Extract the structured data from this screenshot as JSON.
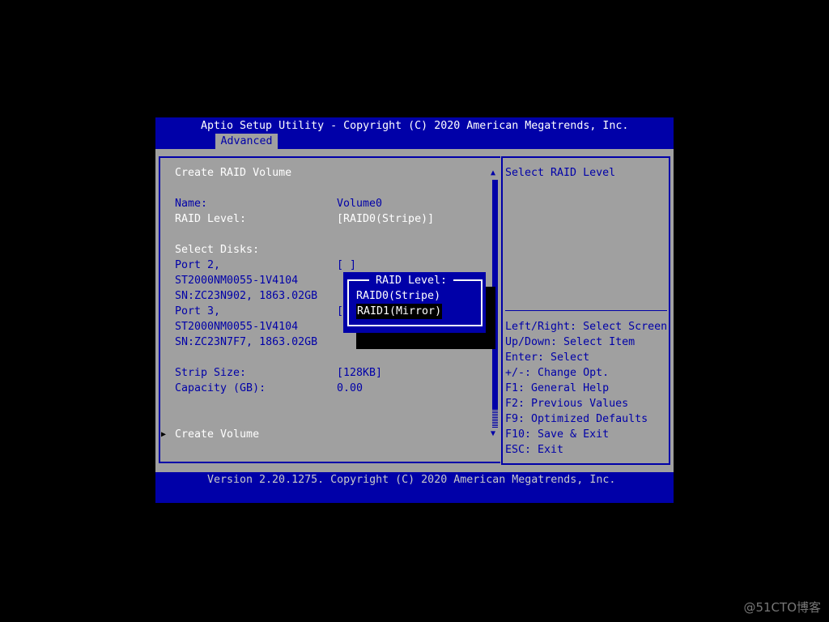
{
  "header": {
    "title": "Aptio Setup Utility - Copyright (C) 2020 American Megatrends, Inc.",
    "tab": "Advanced"
  },
  "main": {
    "title": "Create RAID Volume",
    "name_label": "Name:",
    "name_value": "Volume0",
    "raid_label": "RAID Level:",
    "raid_value": "[RAID0(Stripe)]",
    "select_disks": "Select Disks:",
    "port2": "Port 2,",
    "port2_model": "ST2000NM0055-1V4104",
    "port2_sn": "SN:ZC23N902, 1863.02GB",
    "port2_check": "[ ]",
    "port3": "Port 3,",
    "port3_model": "ST2000NM0055-1V4104",
    "port3_sn": "SN:ZC23N7F7, 1863.02GB",
    "port3_check": "[",
    "strip_label": "Strip Size:",
    "strip_value": "[128KB]",
    "capacity_label": "Capacity (GB):",
    "capacity_value": "0.00",
    "create_volume": "Create Volume"
  },
  "popup": {
    "title": "RAID Level:",
    "options": [
      "RAID0(Stripe)",
      "RAID1(Mirror)"
    ],
    "selected": "RAID1(Mirror)"
  },
  "help": {
    "text": "Select RAID Level",
    "keys": [
      "Left/Right: Select Screen",
      "Up/Down: Select Item",
      "Enter: Select",
      "+/-: Change Opt.",
      "F1: General Help",
      "F2: Previous Values",
      "F9: Optimized Defaults",
      "F10: Save & Exit",
      "ESC: Exit"
    ]
  },
  "footer": {
    "text": "Version 2.20.1275. Copyright (C) 2020 American Megatrends, Inc."
  },
  "watermark": "@51CTO博客",
  "colors": {
    "blue": "#0000a8",
    "gray": "#a0a0a0",
    "white": "#ffffff"
  }
}
